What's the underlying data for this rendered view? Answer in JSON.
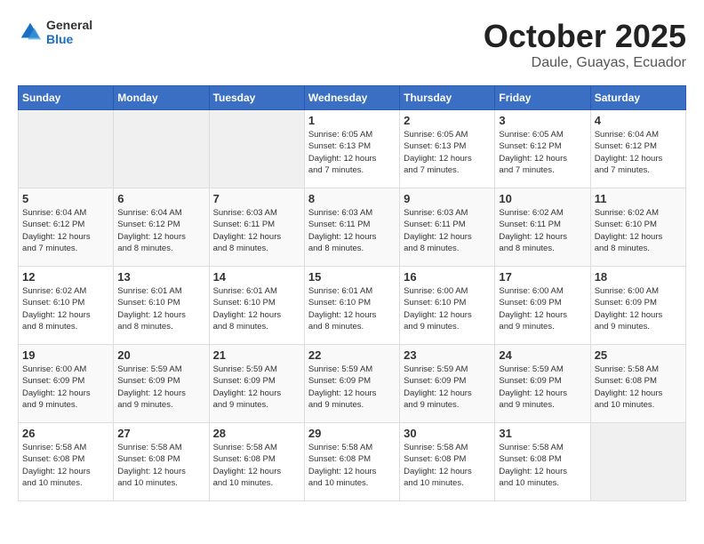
{
  "header": {
    "logo_general": "General",
    "logo_blue": "Blue",
    "title": "October 2025",
    "subtitle": "Daule, Guayas, Ecuador"
  },
  "weekdays": [
    "Sunday",
    "Monday",
    "Tuesday",
    "Wednesday",
    "Thursday",
    "Friday",
    "Saturday"
  ],
  "weeks": [
    [
      {
        "day": "",
        "info": ""
      },
      {
        "day": "",
        "info": ""
      },
      {
        "day": "",
        "info": ""
      },
      {
        "day": "1",
        "info": "Sunrise: 6:05 AM\nSunset: 6:13 PM\nDaylight: 12 hours\nand 7 minutes."
      },
      {
        "day": "2",
        "info": "Sunrise: 6:05 AM\nSunset: 6:13 PM\nDaylight: 12 hours\nand 7 minutes."
      },
      {
        "day": "3",
        "info": "Sunrise: 6:05 AM\nSunset: 6:12 PM\nDaylight: 12 hours\nand 7 minutes."
      },
      {
        "day": "4",
        "info": "Sunrise: 6:04 AM\nSunset: 6:12 PM\nDaylight: 12 hours\nand 7 minutes."
      }
    ],
    [
      {
        "day": "5",
        "info": "Sunrise: 6:04 AM\nSunset: 6:12 PM\nDaylight: 12 hours\nand 7 minutes."
      },
      {
        "day": "6",
        "info": "Sunrise: 6:04 AM\nSunset: 6:12 PM\nDaylight: 12 hours\nand 8 minutes."
      },
      {
        "day": "7",
        "info": "Sunrise: 6:03 AM\nSunset: 6:11 PM\nDaylight: 12 hours\nand 8 minutes."
      },
      {
        "day": "8",
        "info": "Sunrise: 6:03 AM\nSunset: 6:11 PM\nDaylight: 12 hours\nand 8 minutes."
      },
      {
        "day": "9",
        "info": "Sunrise: 6:03 AM\nSunset: 6:11 PM\nDaylight: 12 hours\nand 8 minutes."
      },
      {
        "day": "10",
        "info": "Sunrise: 6:02 AM\nSunset: 6:11 PM\nDaylight: 12 hours\nand 8 minutes."
      },
      {
        "day": "11",
        "info": "Sunrise: 6:02 AM\nSunset: 6:10 PM\nDaylight: 12 hours\nand 8 minutes."
      }
    ],
    [
      {
        "day": "12",
        "info": "Sunrise: 6:02 AM\nSunset: 6:10 PM\nDaylight: 12 hours\nand 8 minutes."
      },
      {
        "day": "13",
        "info": "Sunrise: 6:01 AM\nSunset: 6:10 PM\nDaylight: 12 hours\nand 8 minutes."
      },
      {
        "day": "14",
        "info": "Sunrise: 6:01 AM\nSunset: 6:10 PM\nDaylight: 12 hours\nand 8 minutes."
      },
      {
        "day": "15",
        "info": "Sunrise: 6:01 AM\nSunset: 6:10 PM\nDaylight: 12 hours\nand 8 minutes."
      },
      {
        "day": "16",
        "info": "Sunrise: 6:00 AM\nSunset: 6:10 PM\nDaylight: 12 hours\nand 9 minutes."
      },
      {
        "day": "17",
        "info": "Sunrise: 6:00 AM\nSunset: 6:09 PM\nDaylight: 12 hours\nand 9 minutes."
      },
      {
        "day": "18",
        "info": "Sunrise: 6:00 AM\nSunset: 6:09 PM\nDaylight: 12 hours\nand 9 minutes."
      }
    ],
    [
      {
        "day": "19",
        "info": "Sunrise: 6:00 AM\nSunset: 6:09 PM\nDaylight: 12 hours\nand 9 minutes."
      },
      {
        "day": "20",
        "info": "Sunrise: 5:59 AM\nSunset: 6:09 PM\nDaylight: 12 hours\nand 9 minutes."
      },
      {
        "day": "21",
        "info": "Sunrise: 5:59 AM\nSunset: 6:09 PM\nDaylight: 12 hours\nand 9 minutes."
      },
      {
        "day": "22",
        "info": "Sunrise: 5:59 AM\nSunset: 6:09 PM\nDaylight: 12 hours\nand 9 minutes."
      },
      {
        "day": "23",
        "info": "Sunrise: 5:59 AM\nSunset: 6:09 PM\nDaylight: 12 hours\nand 9 minutes."
      },
      {
        "day": "24",
        "info": "Sunrise: 5:59 AM\nSunset: 6:09 PM\nDaylight: 12 hours\nand 9 minutes."
      },
      {
        "day": "25",
        "info": "Sunrise: 5:58 AM\nSunset: 6:08 PM\nDaylight: 12 hours\nand 10 minutes."
      }
    ],
    [
      {
        "day": "26",
        "info": "Sunrise: 5:58 AM\nSunset: 6:08 PM\nDaylight: 12 hours\nand 10 minutes."
      },
      {
        "day": "27",
        "info": "Sunrise: 5:58 AM\nSunset: 6:08 PM\nDaylight: 12 hours\nand 10 minutes."
      },
      {
        "day": "28",
        "info": "Sunrise: 5:58 AM\nSunset: 6:08 PM\nDaylight: 12 hours\nand 10 minutes."
      },
      {
        "day": "29",
        "info": "Sunrise: 5:58 AM\nSunset: 6:08 PM\nDaylight: 12 hours\nand 10 minutes."
      },
      {
        "day": "30",
        "info": "Sunrise: 5:58 AM\nSunset: 6:08 PM\nDaylight: 12 hours\nand 10 minutes."
      },
      {
        "day": "31",
        "info": "Sunrise: 5:58 AM\nSunset: 6:08 PM\nDaylight: 12 hours\nand 10 minutes."
      },
      {
        "day": "",
        "info": ""
      }
    ]
  ]
}
